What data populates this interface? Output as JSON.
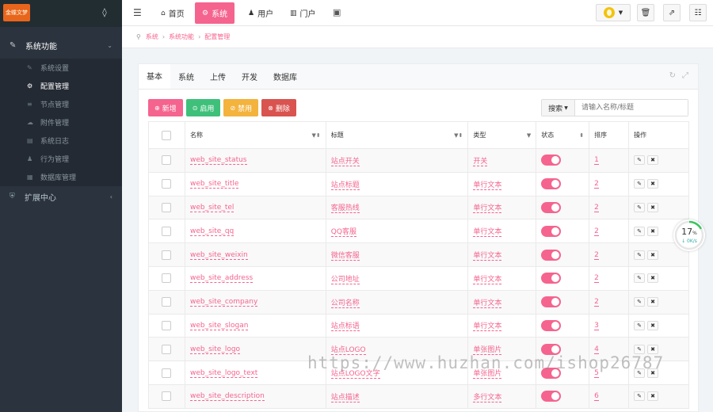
{
  "sidebar": {
    "logo": "金蝶文梦",
    "group1": "系统功能",
    "items": [
      {
        "label": "系统设置",
        "icon": "wrench-icon",
        "glyph": "✎"
      },
      {
        "label": "配置管理",
        "icon": "cogs-icon",
        "glyph": "⚙"
      },
      {
        "label": "节点管理",
        "icon": "list-icon",
        "glyph": "≡"
      },
      {
        "label": "附件管理",
        "icon": "cloud-icon",
        "glyph": "☁"
      },
      {
        "label": "系统日志",
        "icon": "file-icon",
        "glyph": "▤"
      },
      {
        "label": "行为管理",
        "icon": "user-icon",
        "glyph": "♟"
      },
      {
        "label": "数据库管理",
        "icon": "database-icon",
        "glyph": "▦"
      }
    ],
    "group2": "扩展中心"
  },
  "topnav": {
    "items": [
      {
        "label": "首页",
        "glyph": "⌂"
      },
      {
        "label": "系统",
        "glyph": "⚙"
      },
      {
        "label": "用户",
        "glyph": "♟"
      },
      {
        "label": "门户",
        "glyph": "▥"
      }
    ]
  },
  "breadcrumb": [
    "系统",
    "系统功能",
    "配置管理"
  ],
  "tabs": [
    "基本",
    "系统",
    "上传",
    "开发",
    "数据库"
  ],
  "toolbar": {
    "add": "新增",
    "enable": "启用",
    "disable": "禁用",
    "delete": "删除"
  },
  "search": {
    "button": "搜索",
    "placeholder": "请输入名称/标题"
  },
  "table": {
    "headers": {
      "name": "名称",
      "title": "标题",
      "type": "类型",
      "status": "状态",
      "sort": "排序",
      "ops": "操作"
    },
    "rows": [
      {
        "name": "web_site_status",
        "title": "站点开关",
        "type": "开关",
        "sort": "1"
      },
      {
        "name": "web_site_title",
        "title": "站点标题",
        "type": "单行文本",
        "sort": "2"
      },
      {
        "name": "web_site_tel",
        "title": "客服热线",
        "type": "单行文本",
        "sort": "2"
      },
      {
        "name": "web_site_qq",
        "title": "QQ客服",
        "type": "单行文本",
        "sort": "2"
      },
      {
        "name": "web_site_weixin",
        "title": "微信客服",
        "type": "单行文本",
        "sort": "2"
      },
      {
        "name": "web_site_address",
        "title": "公司地址",
        "type": "单行文本",
        "sort": "2"
      },
      {
        "name": "web_site_company",
        "title": "公司名称",
        "type": "单行文本",
        "sort": "2"
      },
      {
        "name": "web_site_slogan",
        "title": "站点标语",
        "type": "单行文本",
        "sort": "3"
      },
      {
        "name": "web_site_logo",
        "title": "站点LOGO",
        "type": "单张图片",
        "sort": "4"
      },
      {
        "name": "web_site_logo_text",
        "title": "站点LOGO文字",
        "type": "单张图片",
        "sort": "5"
      },
      {
        "name": "web_site_description",
        "title": "站点描述",
        "type": "多行文本",
        "sort": "6"
      }
    ]
  },
  "progress": {
    "value": 17,
    "unit": "%",
    "speed": "↓ 0K/s"
  },
  "watermark": "https://www.huzhan.com/ishop26787",
  "colors": {
    "accent": "#f5648e",
    "sidebar": "#2b333e"
  }
}
